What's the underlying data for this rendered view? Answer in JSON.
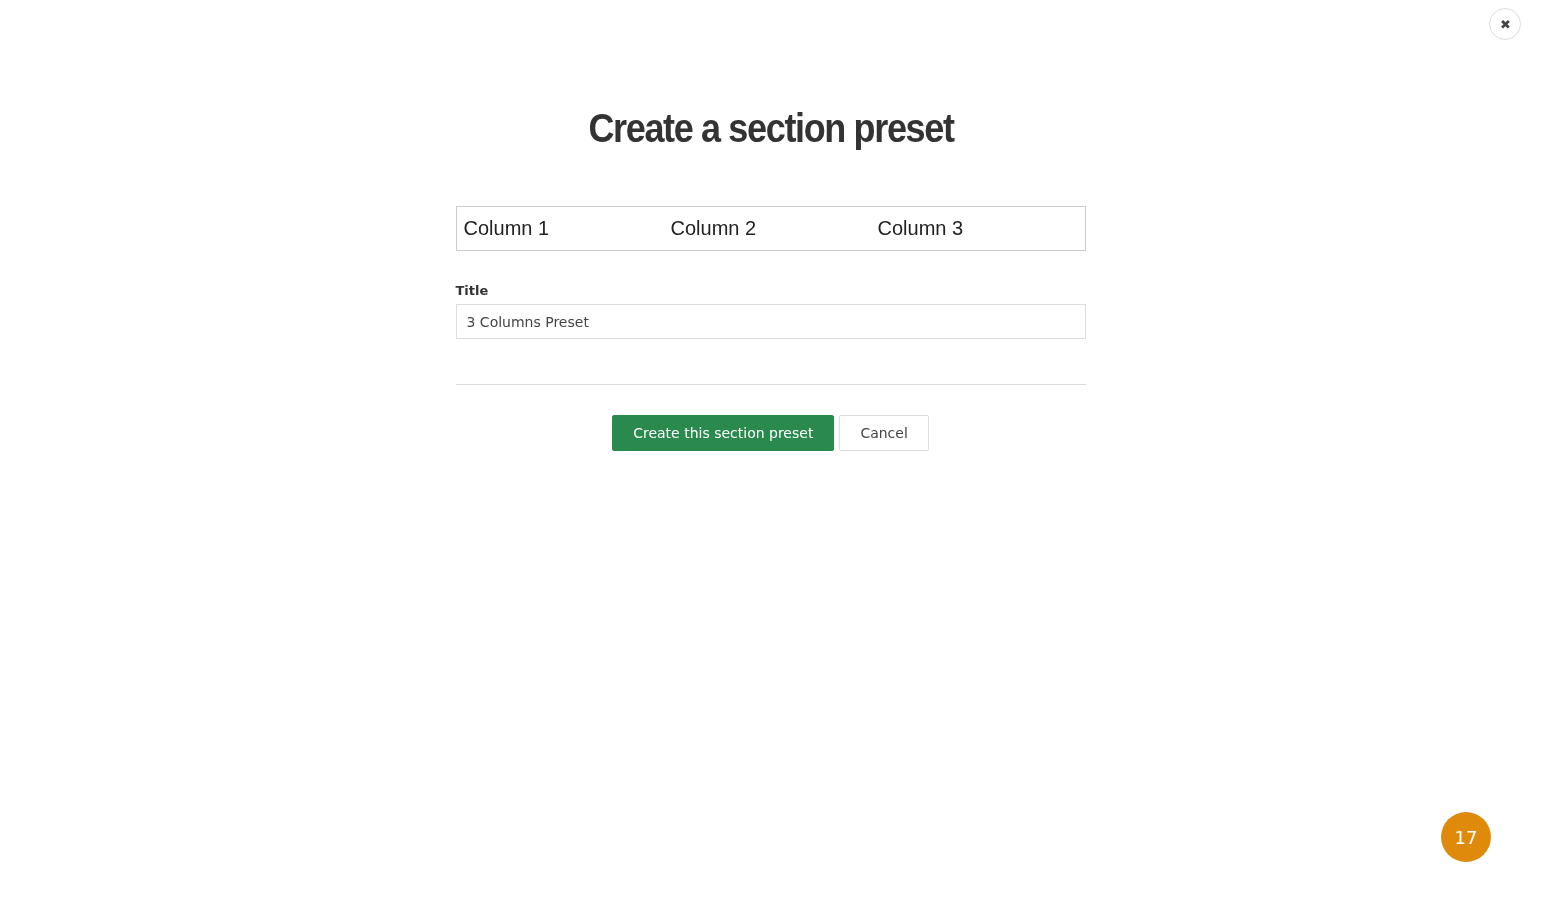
{
  "dialog": {
    "title": "Create a section preset",
    "columns": [
      {
        "label": "Column 1"
      },
      {
        "label": "Column 2"
      },
      {
        "label": "Column 3"
      }
    ],
    "field": {
      "label": "Title",
      "value": "3 Columns Preset"
    },
    "buttons": [
      {
        "label": "Create this section preset",
        "kind": "primary"
      },
      {
        "label": "Cancel",
        "kind": "secondary"
      }
    ]
  },
  "close_button": {
    "label": "✖"
  },
  "step_badge": {
    "label": "17"
  }
}
